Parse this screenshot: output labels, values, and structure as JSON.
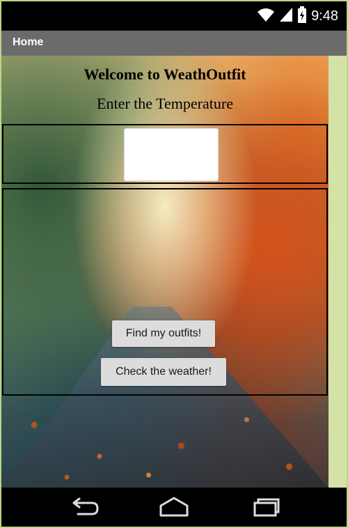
{
  "status_bar": {
    "time": "9:48",
    "icons": [
      "wifi-icon",
      "signal-icon",
      "battery-icon"
    ]
  },
  "app_bar": {
    "title": "Home"
  },
  "main": {
    "welcome_text": "Welcome to WeathOutfit",
    "prompt_text": "Enter the Temperature",
    "temperature_input": {
      "value": "",
      "placeholder": ""
    },
    "buttons": {
      "find_outfits": "Find my outfits!",
      "check_weather": "Check the weather!"
    }
  },
  "nav_bar": {
    "icons": [
      "back-icon",
      "home-icon",
      "recent-apps-icon"
    ]
  },
  "colors": {
    "app_bar": "#6b6b6b",
    "side_strip": "#d3e3a8",
    "button": "#dcdcdc"
  }
}
